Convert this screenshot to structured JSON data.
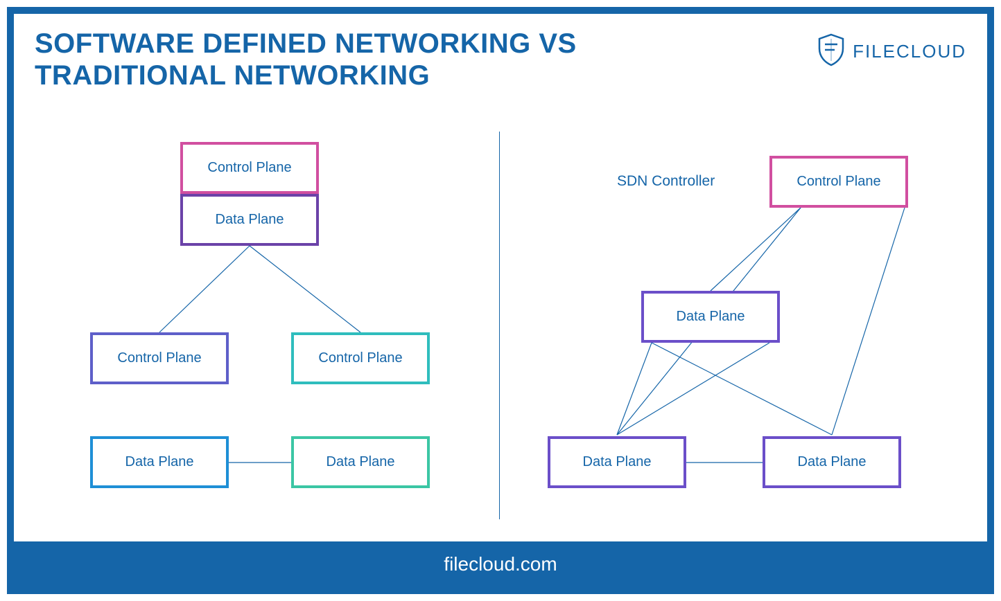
{
  "header": {
    "title_line1": "SOFTWARE DEFINED NETWORKING VS",
    "title_line2": "TRADITIONAL NETWORKING",
    "logo_text": "FILECLOUD"
  },
  "footer": {
    "url": "filecloud.com"
  },
  "colors": {
    "frame": "#1565A8",
    "magenta": "#D14FA0",
    "purple": "#6B42A8",
    "purple_blue": "#5E5FC9",
    "blue": "#1E8FD6",
    "cyan": "#2FBDBD",
    "teal": "#3BC6A4",
    "purple_mid": "#6B4FC9"
  },
  "diagram": {
    "traditional": {
      "top": {
        "control": "Control Plane",
        "data": "Data Plane",
        "control_color": "#D14FA0",
        "data_color": "#6B42A8"
      },
      "left": {
        "control": "Control Plane",
        "data": "Data Plane",
        "control_color": "#5E5FC9",
        "data_color": "#1E8FD6"
      },
      "right": {
        "control": "Control Plane",
        "data": "Data Plane",
        "control_color": "#2FBDBD",
        "data_color": "#3BC6A4"
      }
    },
    "sdn": {
      "controller_label": "SDN Controller",
      "control": "Control Plane",
      "data_mid": "Data Plane",
      "data_left": "Data Plane",
      "data_right": "Data Plane",
      "control_color": "#D14FA0",
      "data_color": "#6B4FC9"
    }
  }
}
